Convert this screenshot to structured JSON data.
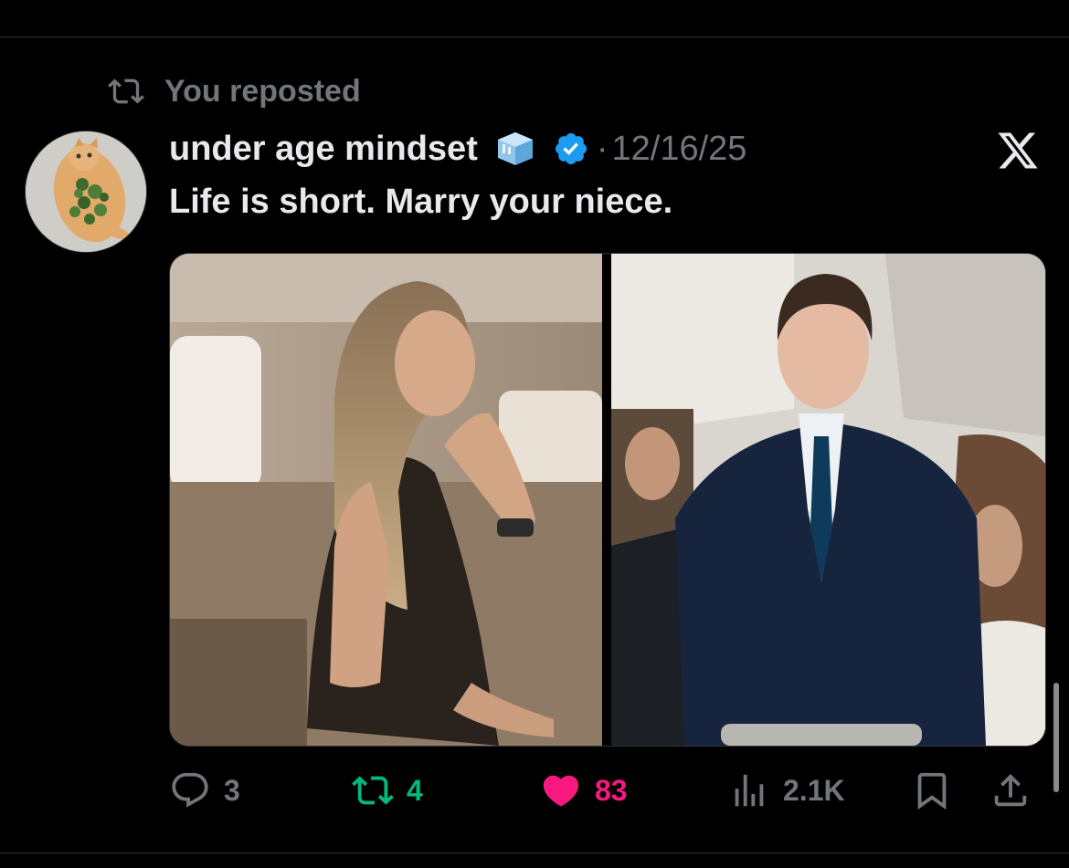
{
  "repost_banner": {
    "text": "You reposted"
  },
  "post": {
    "author_name": "under age mindset",
    "date": "12/16/25",
    "dot": "·",
    "text": "Life is short. Marry your niece."
  },
  "metrics": {
    "replies": "3",
    "reposts": "4",
    "likes": "83",
    "views": "2.1K"
  },
  "icons": {
    "repost_banner": "repost-icon",
    "emoji": "ice-cube-icon",
    "verified": "verified-badge-icon",
    "platform": "x-logo-icon",
    "reply": "reply-icon",
    "repost": "repost-icon",
    "like": "heart-icon",
    "views": "views-icon",
    "bookmark": "bookmark-icon",
    "share": "share-icon"
  },
  "colors": {
    "background": "#000000",
    "muted": "#71767b",
    "text": "#e7e9ea",
    "repost_active": "#00ba7c",
    "like_active": "#f91880",
    "verified": "#1d9bf0"
  }
}
